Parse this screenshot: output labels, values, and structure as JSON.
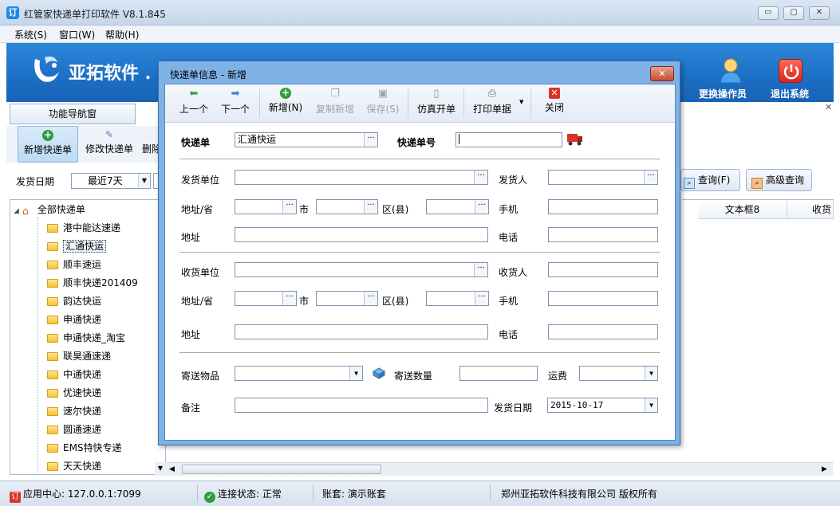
{
  "window": {
    "title": "红管家快递单打印软件 V8.1.845",
    "minimize": "▭",
    "maximize": "▢",
    "close": "✕"
  },
  "menu": {
    "system": "系统(S)",
    "window": "窗口(W)",
    "help": "帮助(H)"
  },
  "banner": {
    "brand": "亚拓软件 .",
    "switch_operator": "更换操作员",
    "exit_system": "退出系统"
  },
  "nav": {
    "title": "功能导航窗"
  },
  "toolbar": {
    "new_label": "新增快递单",
    "edit_label": "修改快递单",
    "delete_label": "删除"
  },
  "filter": {
    "date_label": "发货日期",
    "date_range": "最近7天",
    "query_label": "查询(F)",
    "advanced_query_label": "高级查询"
  },
  "tree": {
    "root": "全部快递单",
    "items": [
      "港中能达速递",
      "汇通快运",
      "顺丰速运",
      "顺丰快递201409",
      "韵达快运",
      "申通快递",
      "申通快递_淘宝",
      "联昊通速递",
      "中通快递",
      "优速快递",
      "速尔快递",
      "圆通速递",
      "EMS特快专递",
      "天天快递"
    ],
    "selected_index": 1
  },
  "grid": {
    "columns": [
      "文本框8",
      "收货"
    ]
  },
  "status": {
    "app_center": "应用中心: 127.0.0.1:7099",
    "connection": "连接状态: 正常",
    "account": "账套: 演示账套",
    "copyright": "郑州亚拓软件科技有限公司 版权所有"
  },
  "dialog": {
    "title": "快递单信息 - 新增",
    "toolbar": {
      "prev": "上一个",
      "next": "下一个",
      "add": "新增(N)",
      "copy_add": "复制新增",
      "save": "保存(S)",
      "template": "仿真开单",
      "print": "打印单据",
      "close": "关闭"
    },
    "courier_label": "快递单",
    "courier_value": "汇通快运",
    "tracking_label": "快递单号",
    "tracking_value": "",
    "sender": {
      "unit_label": "发货单位",
      "person_label": "发货人",
      "province_label": "地址/省",
      "city_label": "市",
      "district_label": "区(县)",
      "mobile_label": "手机",
      "address_label": "地址",
      "phone_label": "电话"
    },
    "receiver": {
      "unit_label": "收货单位",
      "person_label": "收货人",
      "province_label": "地址/省",
      "city_label": "市",
      "district_label": "区(县)",
      "mobile_label": "手机",
      "address_label": "地址",
      "phone_label": "电话"
    },
    "goods_label": "寄送物品",
    "quantity_label": "寄送数量",
    "freight_label": "运费",
    "remarks_label": "备注",
    "ship_date_label": "发货日期",
    "ship_date_value": "2015-10-17"
  },
  "colors": {
    "banner": "#1c6fc4",
    "dialog_frame": "#7eb1e6",
    "accent_green": "#2e9e3a"
  }
}
